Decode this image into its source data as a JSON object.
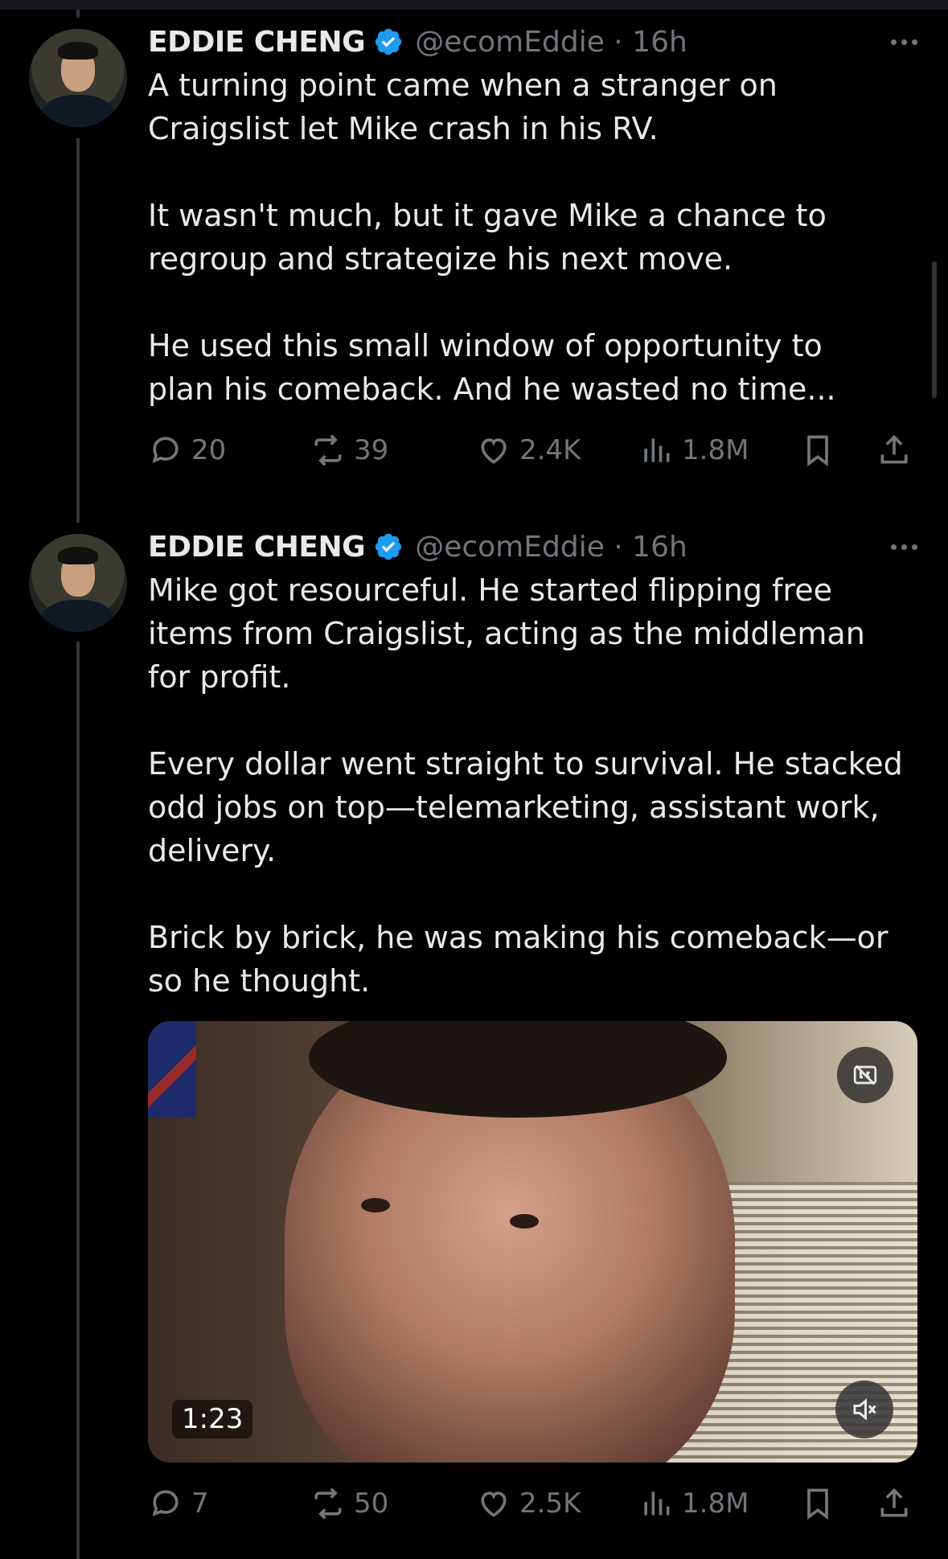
{
  "tweets": [
    {
      "name": "EDDIE CHENG",
      "handle": "@ecomEddie · 16h",
      "text": "A turning point came when a stranger on\nCraigslist let Mike crash in his RV.\n\nIt wasn't much, but it gave Mike a chance to\nregroup and strategize his next move.\n\nHe used this small window of opportunity to\nplan his comeback. And he wasted no time...",
      "replies": "20",
      "reposts": "39",
      "likes": "2.4K",
      "views": "1.8M"
    },
    {
      "name": "EDDIE CHENG",
      "handle": "@ecomEddie · 16h",
      "text": "Mike got resourceful. He started flipping free\nitems from Craigslist, acting as the middleman\nfor profit.\n\nEvery dollar went straight to survival. He stacked\nodd jobs on top—telemarketing, assistant work,\ndelivery.\n\nBrick by brick, he was making his comeback—or\nso he thought.",
      "video_duration": "1:23",
      "replies": "7",
      "reposts": "50",
      "likes": "2.5K",
      "views": "1.8M"
    }
  ],
  "colors": {
    "verified": "#1d9bf0",
    "muted_text": "#71767b",
    "text": "#e7e9ea"
  },
  "icons": [
    "reply-icon",
    "repost-icon",
    "like-icon",
    "views-icon",
    "bookmark-icon",
    "share-icon",
    "more-icon",
    "verified-icon",
    "captions-icon",
    "mute-icon"
  ]
}
